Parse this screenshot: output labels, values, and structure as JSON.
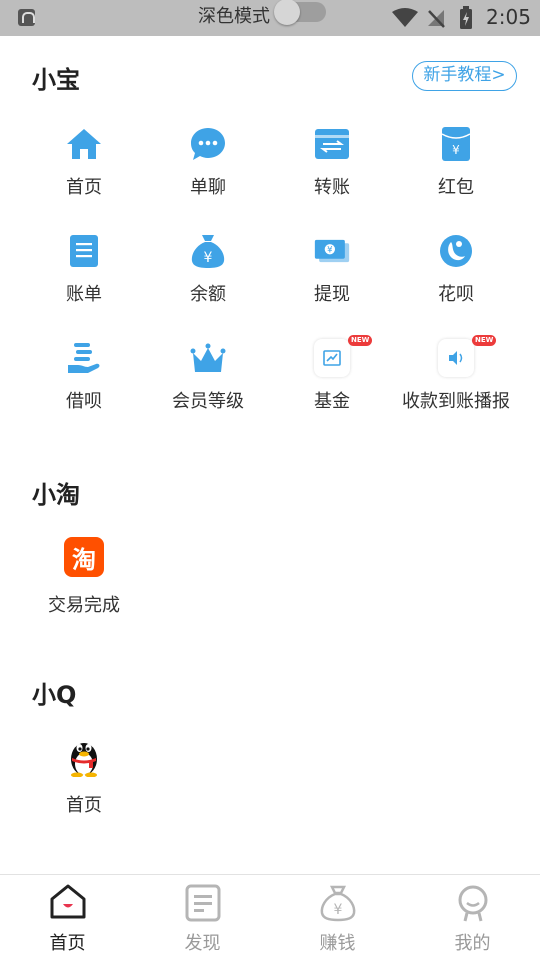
{
  "status_bar": {
    "dark_mode_label": "深色模式",
    "time": "2:05"
  },
  "sections": {
    "xiaobao": {
      "title": "小宝",
      "tutorial_label": "新手教程>",
      "items": [
        {
          "label": "首页",
          "icon": "home-icon"
        },
        {
          "label": "单聊",
          "icon": "chat-bubble-icon"
        },
        {
          "label": "转账",
          "icon": "transfer-icon"
        },
        {
          "label": "红包",
          "icon": "red-packet-icon"
        },
        {
          "label": "账单",
          "icon": "bill-icon"
        },
        {
          "label": "余额",
          "icon": "money-bag-icon"
        },
        {
          "label": "提现",
          "icon": "cash-icon"
        },
        {
          "label": "花呗",
          "icon": "huabei-icon"
        },
        {
          "label": "借呗",
          "icon": "hand-coin-icon"
        },
        {
          "label": "会员等级",
          "icon": "crown-icon"
        },
        {
          "label": "基金",
          "icon": "fund-chart-icon",
          "badge": "NEW"
        },
        {
          "label": "收款到账播报",
          "icon": "speaker-icon",
          "badge": "NEW"
        }
      ]
    },
    "xiaotao": {
      "title": "小淘",
      "items": [
        {
          "label": "交易完成",
          "icon": "taobao-icon",
          "glyph": "淘"
        }
      ]
    },
    "xiaoq": {
      "title": "小Q",
      "items": [
        {
          "label": "首页",
          "icon": "penguin-icon"
        }
      ]
    }
  },
  "bottom_nav": [
    {
      "label": "首页",
      "icon": "home-smile-icon",
      "active": true
    },
    {
      "label": "发现",
      "icon": "document-icon",
      "active": false
    },
    {
      "label": "赚钱",
      "icon": "money-bag-icon",
      "active": false
    },
    {
      "label": "我的",
      "icon": "profile-icon",
      "active": false
    }
  ],
  "colors": {
    "accent_blue": "#3fa3e6",
    "taobao_orange": "#ff5000",
    "badge_red": "#ec3b3b",
    "status_bar_bg": "#bdbdbd"
  }
}
